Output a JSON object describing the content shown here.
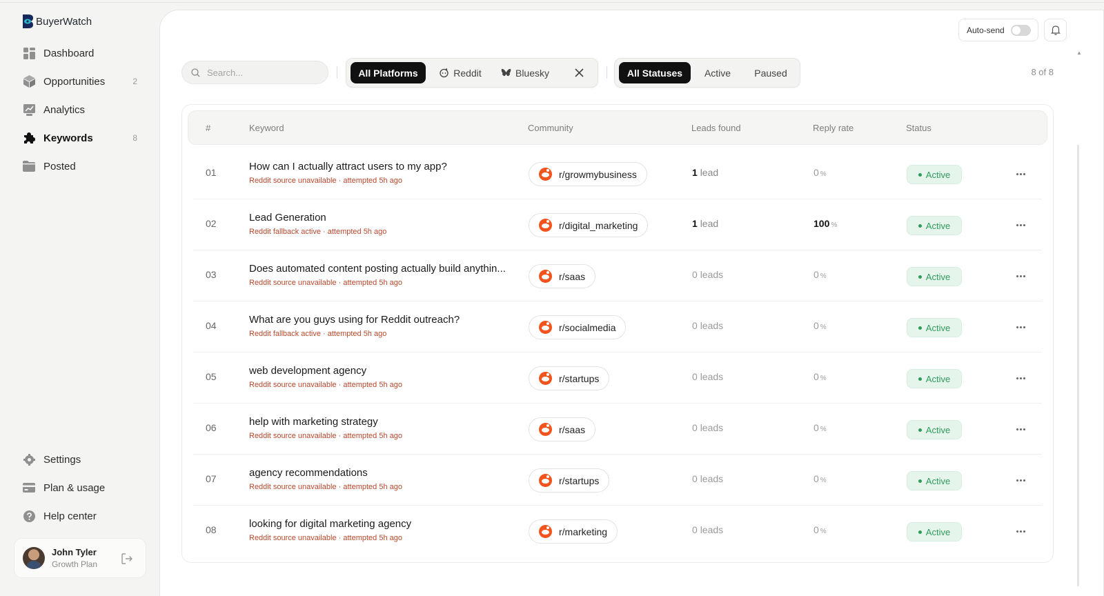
{
  "app": {
    "name": "BuyerWatch"
  },
  "sidebar": {
    "items": [
      {
        "label": "Dashboard",
        "count": ""
      },
      {
        "label": "Opportunities",
        "count": "2"
      },
      {
        "label": "Analytics",
        "count": ""
      },
      {
        "label": "Keywords",
        "count": "8"
      },
      {
        "label": "Posted",
        "count": ""
      }
    ],
    "bottom_items": [
      {
        "label": "Settings"
      },
      {
        "label": "Plan & usage"
      },
      {
        "label": "Help center"
      }
    ],
    "user": {
      "name": "John Tyler",
      "plan": "Growth Plan"
    }
  },
  "header": {
    "autosend_label": "Auto-send",
    "autosend_on": false
  },
  "filters": {
    "search_placeholder": "Search...",
    "platforms": [
      "All Platforms",
      "Reddit",
      "Bluesky",
      "X"
    ],
    "platform_selected": "All Platforms",
    "statuses": [
      "All Statuses",
      "Active",
      "Paused"
    ],
    "status_selected": "All Statuses",
    "result_count": "8 of 8"
  },
  "table": {
    "columns": [
      "#",
      "Keyword",
      "Community",
      "Leads found",
      "Reply rate",
      "Status"
    ],
    "rows": [
      {
        "num": "01",
        "keyword": "How can I actually attract users to my app?",
        "note": "Reddit source unavailable · attempted 5h ago",
        "community": "r/growmybusiness",
        "leads_n": "1",
        "leads_word": "lead",
        "rate": "0",
        "rate_unit": "%",
        "status": "Active"
      },
      {
        "num": "02",
        "keyword": "Lead Generation",
        "note": "Reddit fallback active · attempted 5h ago",
        "community": "r/digital_marketing",
        "leads_n": "1",
        "leads_word": "lead",
        "rate": "100",
        "rate_unit": "%",
        "status": "Active"
      },
      {
        "num": "03",
        "keyword": "Does automated content posting actually build anythin...",
        "note": "Reddit source unavailable · attempted 5h ago",
        "community": "r/saas",
        "leads_n": "0",
        "leads_word": "leads",
        "rate": "0",
        "rate_unit": "%",
        "status": "Active"
      },
      {
        "num": "04",
        "keyword": "What are you guys using for Reddit outreach?",
        "note": "Reddit fallback active · attempted 5h ago",
        "community": "r/socialmedia",
        "leads_n": "0",
        "leads_word": "leads",
        "rate": "0",
        "rate_unit": "%",
        "status": "Active"
      },
      {
        "num": "05",
        "keyword": "web development agency",
        "note": "Reddit source unavailable · attempted 5h ago",
        "community": "r/startups",
        "leads_n": "0",
        "leads_word": "leads",
        "rate": "0",
        "rate_unit": "%",
        "status": "Active"
      },
      {
        "num": "06",
        "keyword": "help with marketing strategy",
        "note": "Reddit source unavailable · attempted 5h ago",
        "community": "r/saas",
        "leads_n": "0",
        "leads_word": "leads",
        "rate": "0",
        "rate_unit": "%",
        "status": "Active"
      },
      {
        "num": "07",
        "keyword": "agency recommendations",
        "note": "Reddit source unavailable · attempted 5h ago",
        "community": "r/startups",
        "leads_n": "0",
        "leads_word": "leads",
        "rate": "0",
        "rate_unit": "%",
        "status": "Active"
      },
      {
        "num": "08",
        "keyword": "looking for digital marketing agency",
        "note": "Reddit source unavailable · attempted 5h ago",
        "community": "r/marketing",
        "leads_n": "0",
        "leads_word": "leads",
        "rate": "0",
        "rate_unit": "%",
        "status": "Active"
      }
    ]
  },
  "colors": {
    "accent": "#111111",
    "reddit": "#f2541b",
    "status_active": "#2e9b5c",
    "warning_text": "#b8472b"
  },
  "icons": [
    "dashboard-icon",
    "opportunities-icon",
    "analytics-icon",
    "keywords-icon",
    "posted-icon",
    "settings-icon",
    "plan-icon",
    "help-icon",
    "logout-icon",
    "bell-icon",
    "search-icon",
    "reddit-icon",
    "bluesky-icon",
    "x-icon",
    "more-icon"
  ]
}
